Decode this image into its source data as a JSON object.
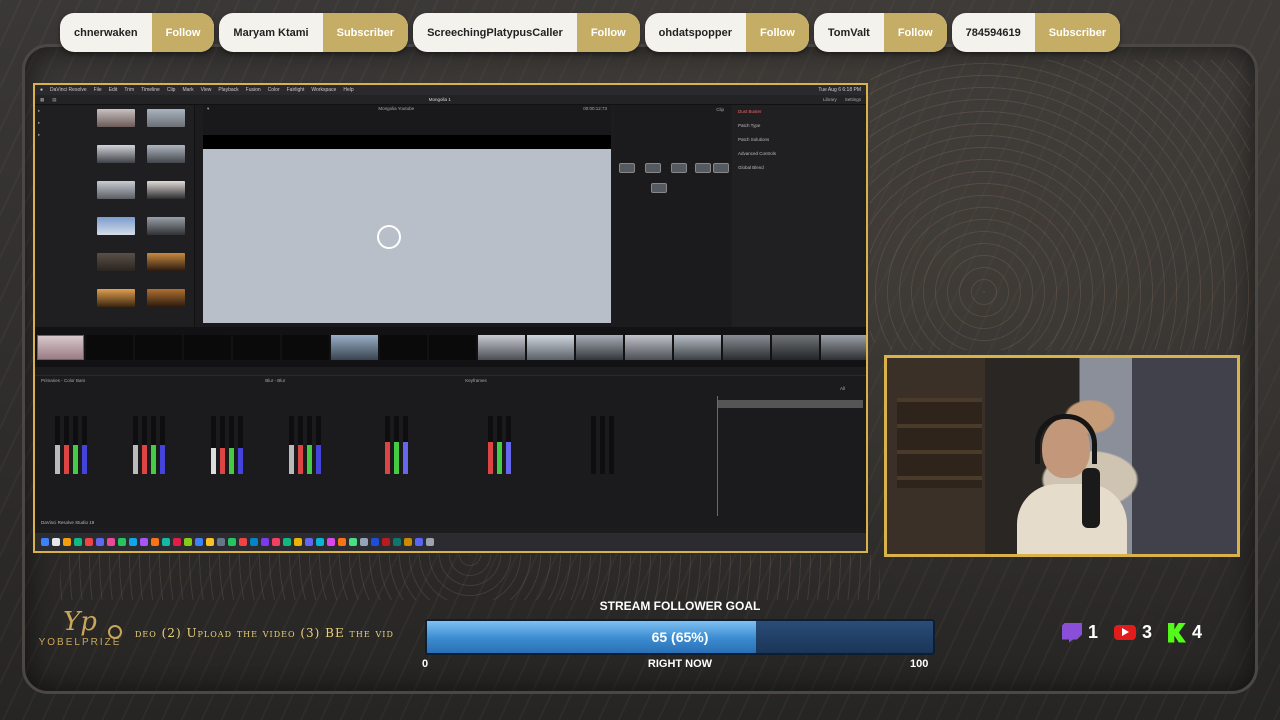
{
  "alerts": [
    {
      "name": "chnerwaken",
      "action": "Follow"
    },
    {
      "name": "Maryam Ktami",
      "action": "Subscriber"
    },
    {
      "name": "ScreechingPlatypusCaller",
      "action": "Follow"
    },
    {
      "name": "ohdatspopper",
      "action": "Follow"
    },
    {
      "name": "TomValt",
      "action": "Follow"
    },
    {
      "name": "784594619",
      "action": "Subscriber"
    }
  ],
  "app": {
    "menu": [
      "DaVinci Resolve",
      "File",
      "Edit",
      "Trim",
      "Timeline",
      "Clip",
      "Mark",
      "View",
      "Playback",
      "Fusion",
      "Color",
      "Fairlight",
      "Workspace",
      "Help"
    ],
    "clock": "Tue Aug 6  6:18 PM",
    "project_title": "Mongolia 1",
    "viewer_timecode": "00:00:12:73",
    "viewer_label": "Mongolia Youtube",
    "transport_timecode": "00:00:00:00",
    "clip_mode": "Clip",
    "inspector": {
      "tab1": "Library",
      "tab2": "Settings",
      "section": "Dust Buster",
      "fields": [
        "Patch Type",
        "Patch Solutions",
        "Advanced Controls",
        "Global Blend"
      ]
    },
    "colorpanel": {
      "primaries": "Primaries - Color Bars",
      "blur": "Blur - Blur",
      "keyframes": "Keyframes",
      "keyframes_all": "All"
    },
    "app_name_footer": "DaVinci Resolve Studio 19"
  },
  "ticker": {
    "text": "deo (2) Upload the video (3) BE the vid"
  },
  "logo": {
    "mark": "Yp",
    "name": "YOBELPRIZE"
  },
  "goal": {
    "title": "STREAM FOLLOWER GOAL",
    "current": 65,
    "max": 100,
    "min": 0,
    "label": "65 (65%)",
    "now_label": "RIGHT NOW",
    "min_label": "0",
    "max_label": "100",
    "progress_percent": 65,
    "bar_color": "#3a8bd0"
  },
  "platforms": {
    "twitch_count": "1",
    "youtube_count": "3",
    "kick_count": "4",
    "twitch_color": "#8a4fd8",
    "youtube_color": "#e21b1b",
    "kick_color": "#53fc18"
  }
}
